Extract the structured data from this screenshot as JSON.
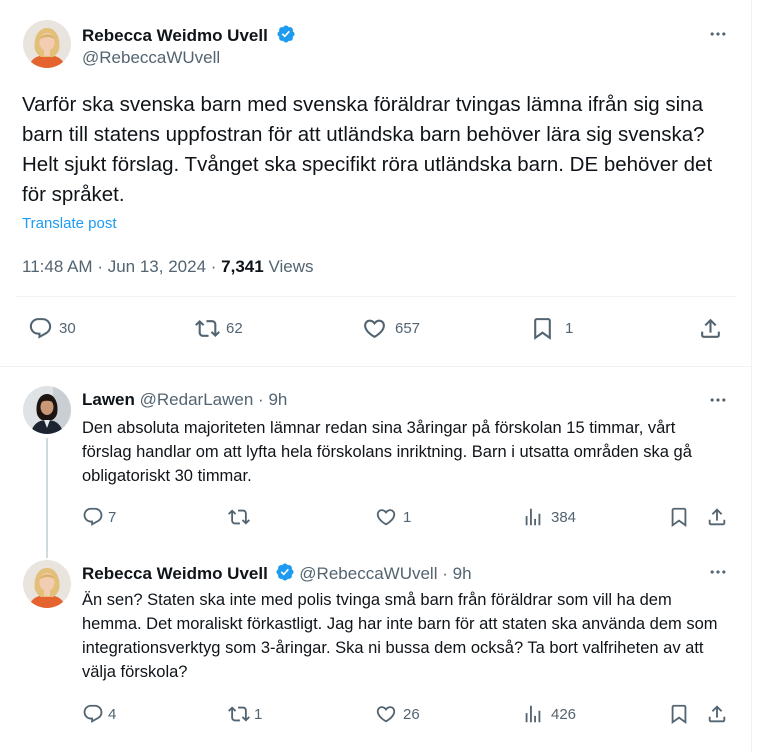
{
  "main_post": {
    "author_name": "Rebecca Weidmo Uvell",
    "handle": "@RebeccaWUvell",
    "text": "Varför ska svenska barn med svenska föräldrar tvingas lämna ifrån sig sina barn till statens uppfostran för att utländska barn behöver lära sig svenska? Helt sjukt förslag. Tvånget ska specifikt röra utländska barn. DE behöver det för språket.",
    "translate_label": "Translate post",
    "time": "11:48 AM",
    "date": "Jun 13, 2024",
    "views_count": "7,341",
    "views_label": "Views",
    "replies": "30",
    "reposts": "62",
    "likes": "657",
    "bookmarks": "1"
  },
  "replies": [
    {
      "author_name": "Lawen",
      "handle": "@RedarLawen",
      "age": "9h",
      "text": "Den absoluta majoriteten lämnar redan sina 3åringar på förskolan 15 timmar, vårt förslag handlar om att lyfta hela förskolans inriktning. Barn i utsatta områden ska gå obligatoriskt 30 timmar.",
      "replies": "7",
      "reposts": "",
      "likes": "1",
      "views": "384"
    },
    {
      "author_name": "Rebecca Weidmo Uvell",
      "handle": "@RebeccaWUvell",
      "age": "9h",
      "text": "Än sen? Staten ska inte med polis tvinga små barn från föräldrar som vill ha dem hemma. Det moraliskt förkastligt. Jag har inte barn för att staten ska använda dem som integrationsverktyg som 3-åringar. Ska ni bussa dem också? Ta bort valfriheten av att välja förskola?",
      "replies": "4",
      "reposts": "1",
      "likes": "26",
      "views": "426"
    }
  ],
  "separator": "·",
  "colors": {
    "link": "#1d9bf0",
    "verified": "#1d9bf0",
    "muted": "#536471",
    "text": "#0f1419"
  }
}
